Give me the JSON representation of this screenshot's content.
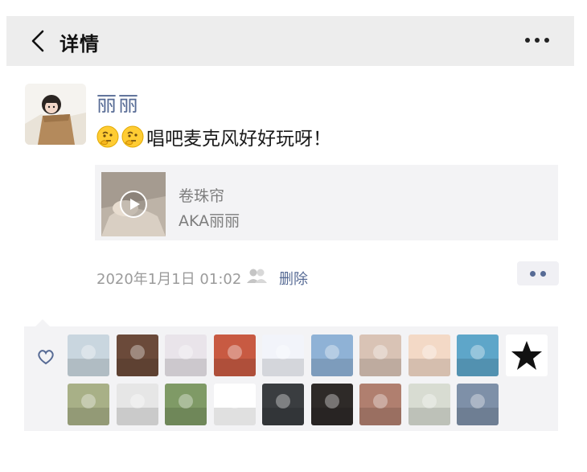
{
  "nav": {
    "title": "详情",
    "back_icon": "chevron-left-icon",
    "more_icon": "more-horizontal-icon"
  },
  "post": {
    "author": "丽丽",
    "text": "唱吧麦克风好好玩呀！",
    "emoji_count": 2,
    "music": {
      "title": "卷珠帘",
      "artist": "AKA丽丽"
    },
    "timestamp": "2020年1月1日 01:02",
    "delete_label": "删除"
  },
  "likes": {
    "icon": "heart-icon",
    "avatars_row1": [
      "#c9d6df",
      "#6b4a3a",
      "#e9e4ea",
      "#c85a42",
      "#f2f4fa",
      "#8fb2d6",
      "#d9c3b5",
      "#f3d9c6",
      "#5ea6c9",
      "#ffffff"
    ],
    "avatars_row2": [
      "#a8b087",
      "#e6e6e6",
      "#7f9a66",
      "#ffffff",
      "#3a3d40",
      "#2e2a28",
      "#b07f6f",
      "#d8dcd2",
      "#7e90a8"
    ]
  },
  "colors": {
    "link": "#576b95",
    "panel": "#f3f3f5",
    "nav_bg": "#ededed"
  }
}
